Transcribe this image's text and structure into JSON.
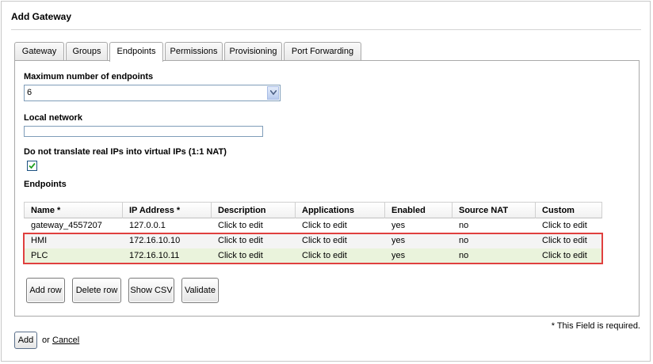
{
  "page": {
    "title": "Add Gateway"
  },
  "tabs": [
    {
      "label": "Gateway"
    },
    {
      "label": "Groups"
    },
    {
      "label": "Endpoints",
      "active": true
    },
    {
      "label": "Permissions"
    },
    {
      "label": "Provisioning"
    },
    {
      "label": "Port Forwarding"
    }
  ],
  "form": {
    "max_endpoints_label": "Maximum number of endpoints",
    "max_endpoints_value": "6",
    "local_network_label": "Local network",
    "local_network_value": "",
    "nat_label": "Do not translate real IPs into virtual IPs (1:1 NAT)",
    "nat_checked": true,
    "endpoints_label": "Endpoints"
  },
  "grid": {
    "columns": [
      "Name *",
      "IP Address *",
      "Description",
      "Applications",
      "Enabled",
      "Source NAT",
      "Custom"
    ],
    "rows": [
      [
        "gateway_4557207",
        "127.0.0.1",
        "Click to edit",
        "Click to edit",
        "yes",
        "no",
        "Click to edit"
      ],
      [
        "HMI",
        "172.16.10.10",
        "Click to edit",
        "Click to edit",
        "yes",
        "no",
        "Click to edit"
      ],
      [
        "PLC",
        "172.16.10.11",
        "Click to edit",
        "Click to edit",
        "yes",
        "no",
        "Click to edit"
      ]
    ],
    "highlighted_rows": [
      1,
      2
    ],
    "highlight_color": "#e0403f"
  },
  "buttons": {
    "add_row": "Add row",
    "delete_row": "Delete row",
    "show_csv": "Show CSV",
    "validate": "Validate"
  },
  "footer": {
    "required_note": "* This Field is required.",
    "add": "Add",
    "or": "or",
    "cancel": "Cancel"
  }
}
